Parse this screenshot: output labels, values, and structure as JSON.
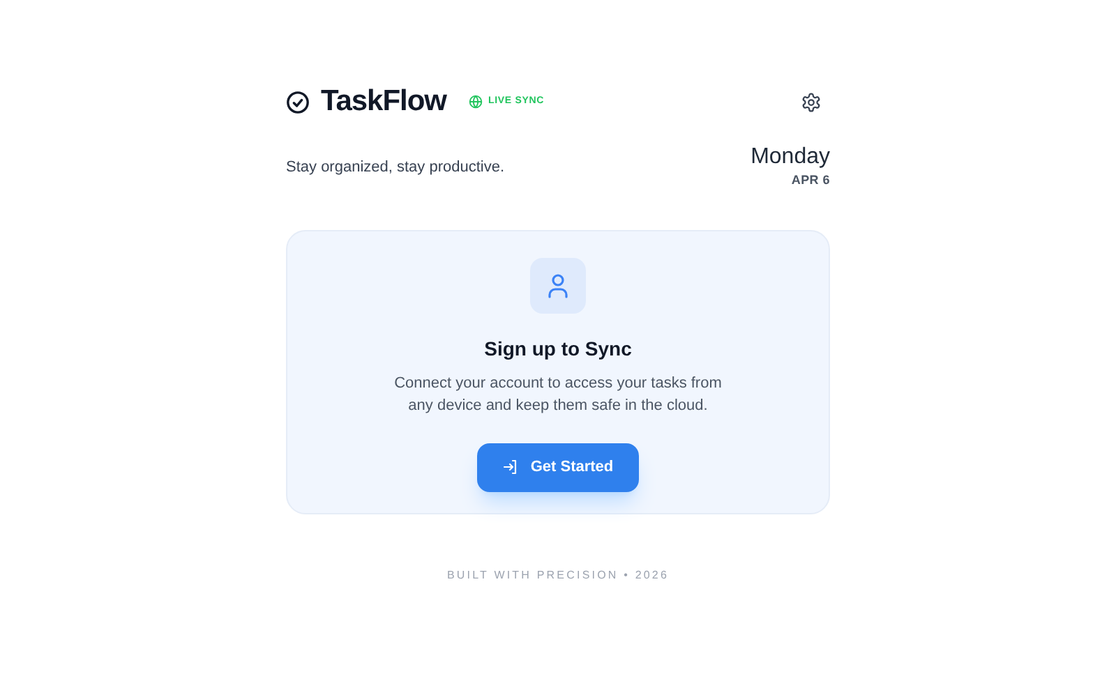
{
  "header": {
    "title": "TaskFlow",
    "badge": "LIVE SYNC"
  },
  "tagline": "Stay organized, stay productive.",
  "date": {
    "weekday": "Monday",
    "day": "APR 6"
  },
  "card": {
    "heading": "Sign up to Sync",
    "body": "Connect your account to access your tasks from any device and keep them safe in the cloud.",
    "button": "Get Started"
  },
  "footer": "BUILT WITH PRECISION • 2026"
}
